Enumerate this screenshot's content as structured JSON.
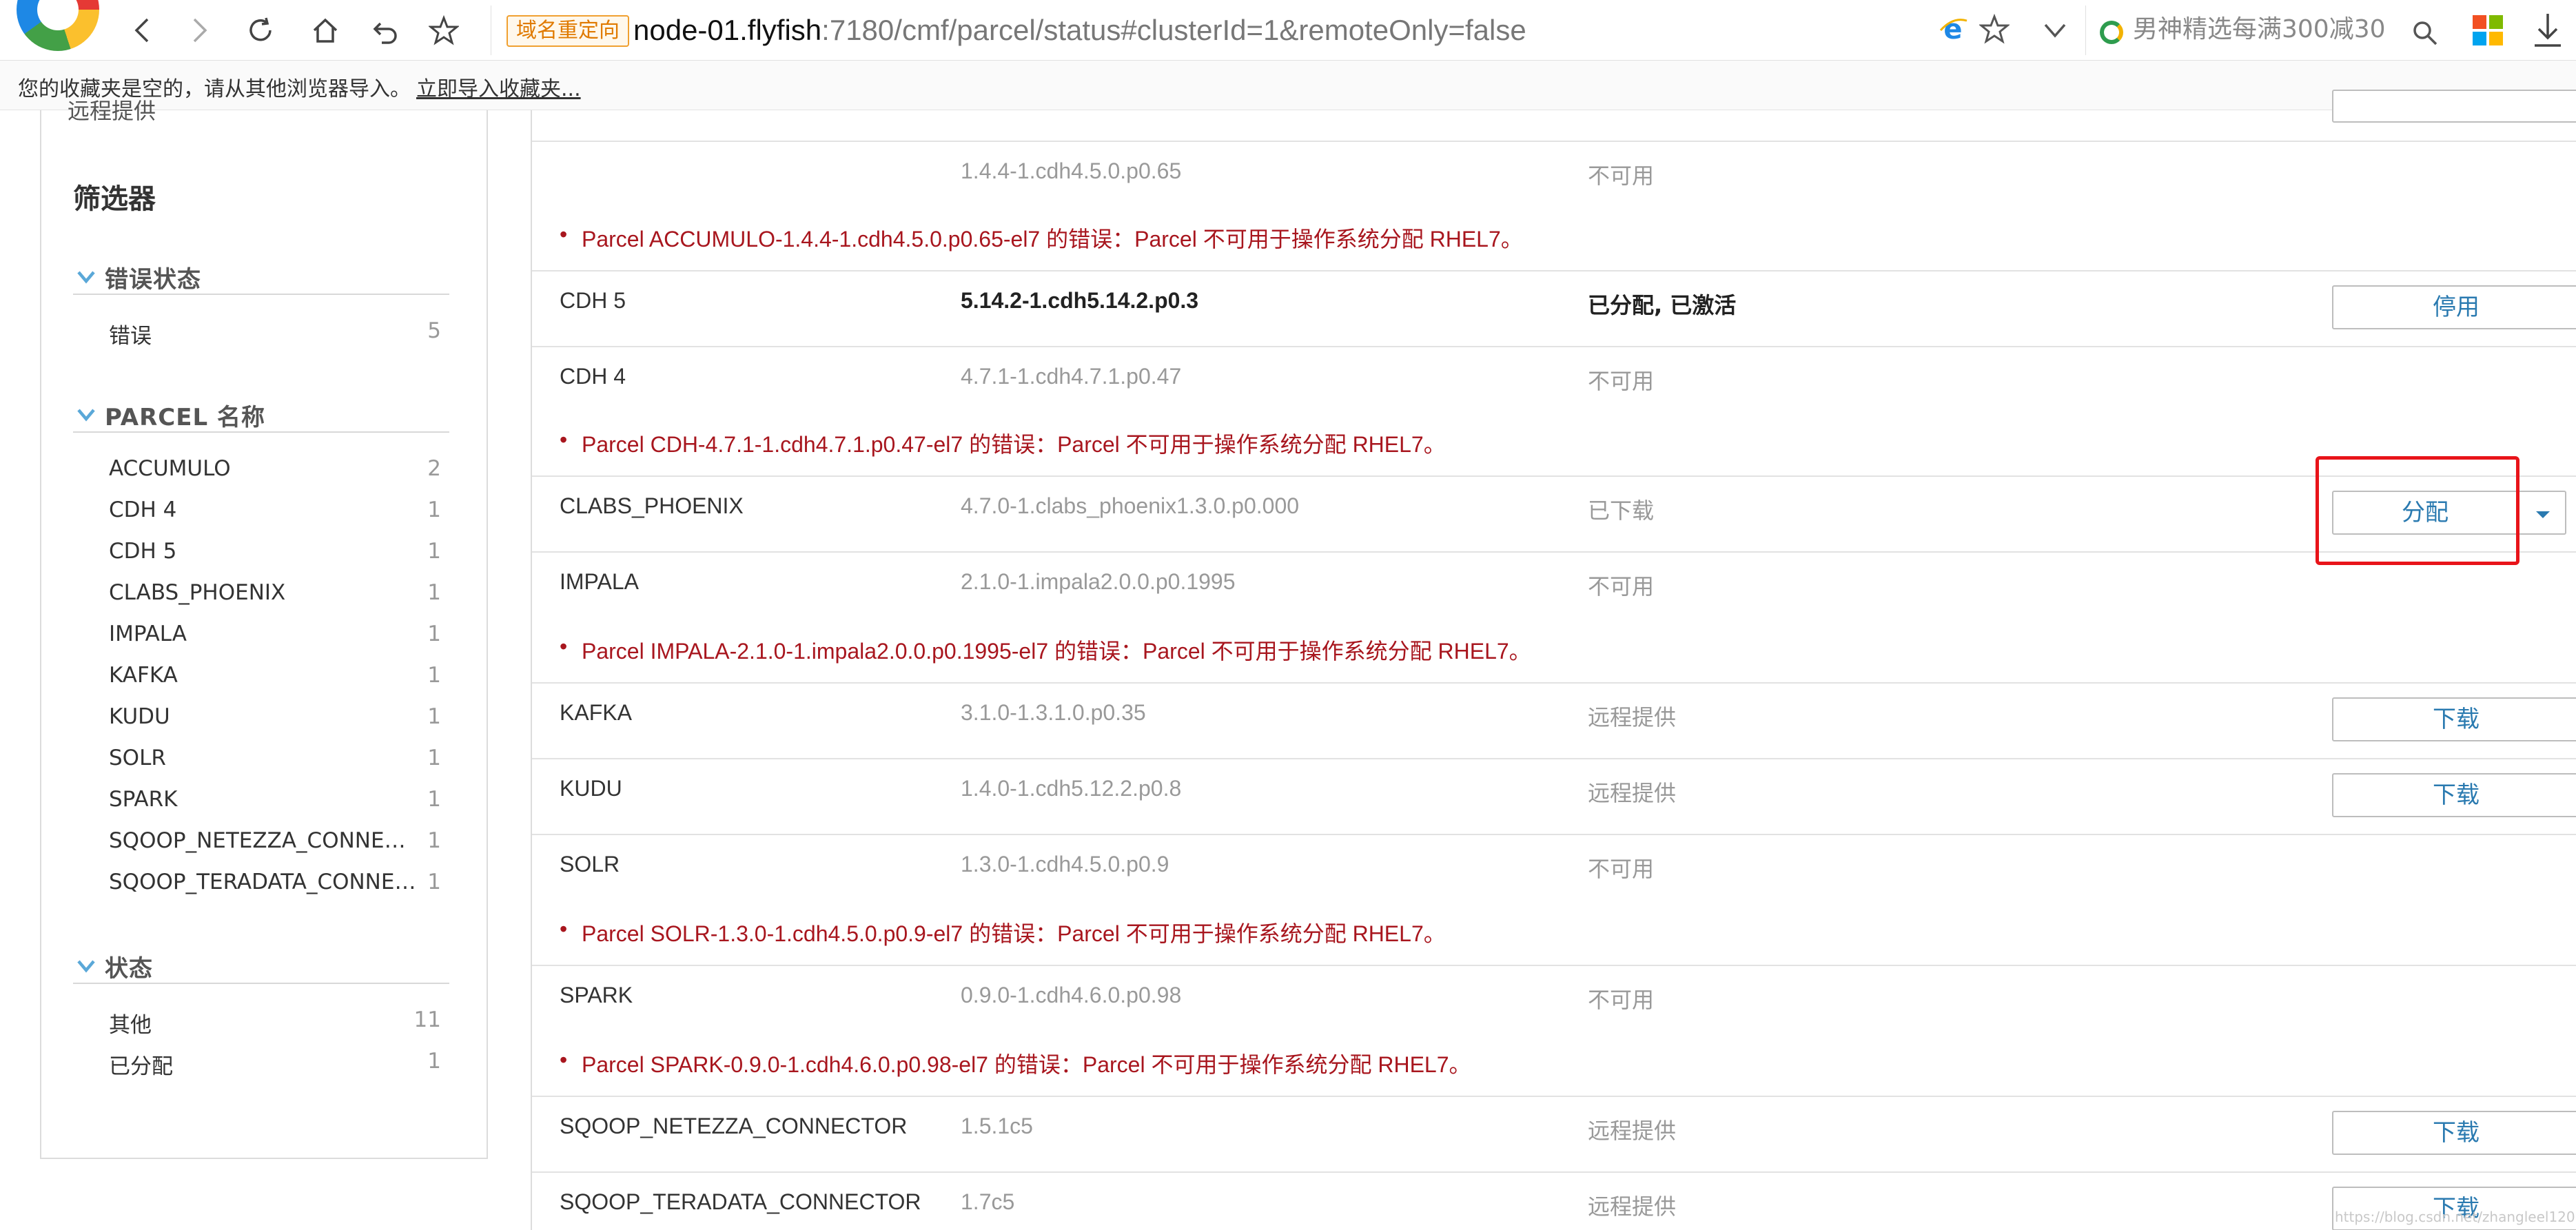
{
  "browser": {
    "redirect_badge": "域名重定向",
    "url_host": "node-01.flyfish",
    "url_rest": ":7180/cmf/parcel/status#clusterId=1&remoteOnly=false",
    "search_text": "男神精选每满300减30"
  },
  "bookmarks_bar": {
    "message": "您的收藏夹是空的，请从其他浏览器导入。",
    "import_link": "立即导入收藏夹..."
  },
  "sidebar": {
    "cut_off_item": "远程提供",
    "title": "筛选器",
    "groups": [
      {
        "label": "错误状态",
        "items": [
          {
            "name": "错误",
            "count": "5"
          }
        ]
      },
      {
        "label": "PARCEL 名称",
        "items": [
          {
            "name": "ACCUMULO",
            "count": "2"
          },
          {
            "name": "CDH 4",
            "count": "1"
          },
          {
            "name": "CDH 5",
            "count": "1"
          },
          {
            "name": "CLABS_PHOENIX",
            "count": "1"
          },
          {
            "name": "IMPALA",
            "count": "1"
          },
          {
            "name": "KAFKA",
            "count": "1"
          },
          {
            "name": "KUDU",
            "count": "1"
          },
          {
            "name": "SOLR",
            "count": "1"
          },
          {
            "name": "SPARK",
            "count": "1"
          },
          {
            "name": "SQOOP_NETEZZA_CONNECTOR",
            "count": "1"
          },
          {
            "name": "SQOOP_TERADATA_CONNECTOR",
            "count": "1"
          }
        ]
      },
      {
        "label": "状态",
        "items": [
          {
            "name": "其他",
            "count": "11"
          },
          {
            "name": "已分配",
            "count": "1"
          }
        ]
      }
    ]
  },
  "parcels": [
    {
      "name": "",
      "version": "1.4.4-1.cdh4.5.0.p0.65",
      "state": "不可用",
      "error": "Parcel ACCUMULO-1.4.4-1.cdh4.5.0.p0.65-el7 的错误：Parcel 不可用于操作系统分配 RHEL7。"
    },
    {
      "name": "CDH 5",
      "version": "5.14.2-1.cdh5.14.2.p0.3",
      "state": "已分配, 已激活",
      "action": "停用"
    },
    {
      "name": "CDH 4",
      "version": "4.7.1-1.cdh4.7.1.p0.47",
      "state": "不可用",
      "error": "Parcel CDH-4.7.1-1.cdh4.7.1.p0.47-el7 的错误：Parcel 不可用于操作系统分配 RHEL7。"
    },
    {
      "name": "CLABS_PHOENIX",
      "version": "4.7.0-1.clabs_phoenix1.3.0.p0.000",
      "state": "已下载",
      "action": "分配"
    },
    {
      "name": "IMPALA",
      "version": "2.1.0-1.impala2.0.0.p0.1995",
      "state": "不可用",
      "error": "Parcel IMPALA-2.1.0-1.impala2.0.0.p0.1995-el7 的错误：Parcel 不可用于操作系统分配 RHEL7。"
    },
    {
      "name": "KAFKA",
      "version": "3.1.0-1.3.1.0.p0.35",
      "state": "远程提供",
      "action": "下载"
    },
    {
      "name": "KUDU",
      "version": "1.4.0-1.cdh5.12.2.p0.8",
      "state": "远程提供",
      "action": "下载"
    },
    {
      "name": "SOLR",
      "version": "1.3.0-1.cdh4.5.0.p0.9",
      "state": "不可用",
      "error": "Parcel SOLR-1.3.0-1.cdh4.5.0.p0.9-el7 的错误：Parcel 不可用于操作系统分配 RHEL7。"
    },
    {
      "name": "SPARK",
      "version": "0.9.0-1.cdh4.6.0.p0.98",
      "state": "不可用",
      "error": "Parcel SPARK-0.9.0-1.cdh4.6.0.p0.98-el7 的错误：Parcel 不可用于操作系统分配 RHEL7。"
    },
    {
      "name": "SQOOP_NETEZZA_CONNECTOR",
      "version": "1.5.1c5",
      "state": "远程提供",
      "action": "下载"
    },
    {
      "name": "SQOOP_TERADATA_CONNECTOR",
      "version": "1.7c5",
      "state": "远程提供",
      "action": "下载"
    }
  ],
  "watermark": "https://blog.csdn.net/zhangleel120"
}
